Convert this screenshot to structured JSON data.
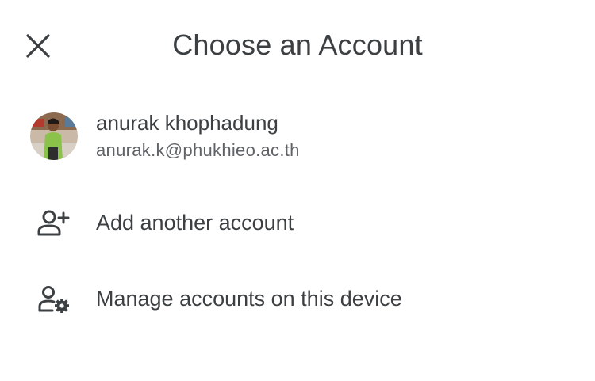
{
  "header": {
    "title": "Choose an Account"
  },
  "account": {
    "name": "anurak khophadung",
    "email": "anurak.k@phukhieo.ac.th"
  },
  "actions": [
    {
      "label": "Add another account",
      "icon": "person-add-icon"
    },
    {
      "label": "Manage accounts on this device",
      "icon": "manage-accounts-icon"
    }
  ],
  "colors": {
    "text": "#3c4043",
    "secondary_text": "#5f6368",
    "background": "#ffffff"
  }
}
